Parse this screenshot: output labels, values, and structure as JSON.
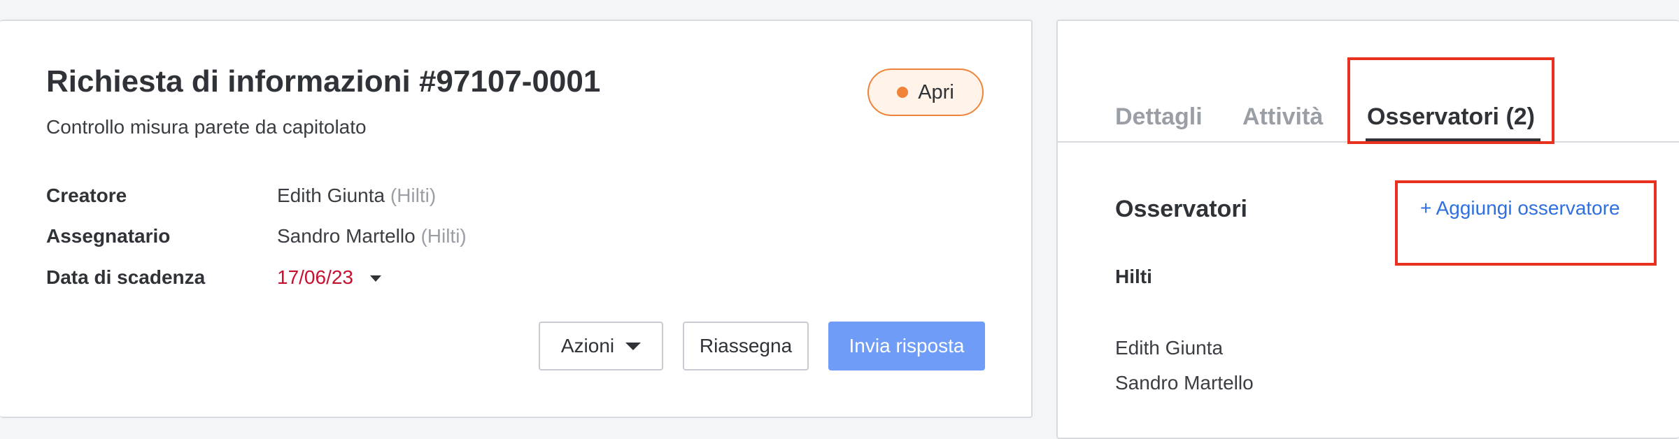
{
  "request": {
    "title": "Richiesta di informazioni #97107-0001",
    "subtitle": "Controllo misura parete da capitolato",
    "status": "Apri",
    "fields": [
      {
        "label": "Creatore",
        "name": "Edith Giunta",
        "org": "(Hilti)"
      },
      {
        "label": "Assegnatario",
        "name": "Sandro Martello",
        "org": "(Hilti)"
      },
      {
        "label": "Data di scadenza",
        "value": "17/06/23"
      }
    ],
    "buttons": {
      "actions": "Azioni",
      "reassign": "Riassegna",
      "send": "Invia risposta"
    }
  },
  "tabs": [
    {
      "label": "Dettagli"
    },
    {
      "label": "Attività"
    },
    {
      "label": "Osservatori (2)",
      "active": true
    }
  ],
  "observers": {
    "title": "Osservatori",
    "add_label": "+ Aggiungi osservatore",
    "group": "Hilti",
    "people": [
      "Edith Giunta",
      "Sandro Martello"
    ]
  },
  "colors": {
    "status_accent": "#f0833a",
    "due_date": "#c8102e",
    "primary_button": "#6e9cf7",
    "link": "#2f6fe0",
    "highlight": "#e8311f"
  }
}
